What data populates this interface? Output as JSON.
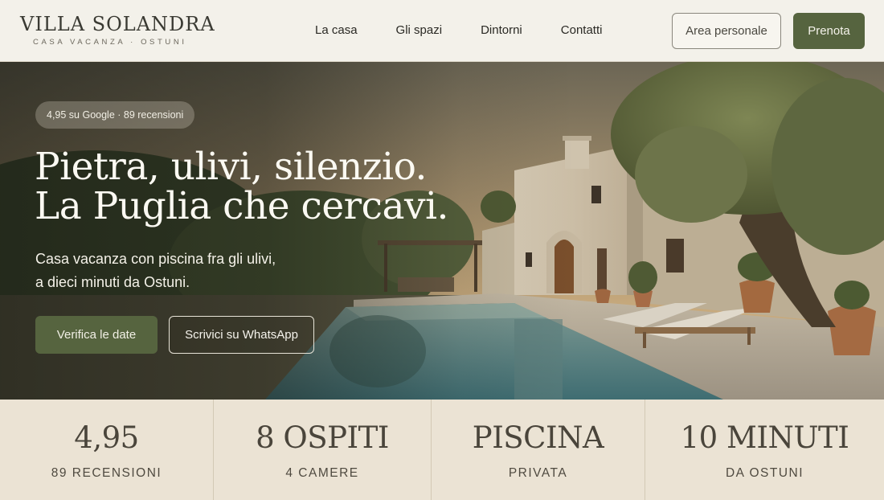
{
  "header": {
    "logo_name": "VILLA SOLANDRA",
    "logo_sub": "CASA VACANZA · OSTUNI",
    "nav": [
      "La casa",
      "Gli spazi",
      "Dintorni",
      "Contatti"
    ],
    "area_label": "Area personale",
    "book_label": "Prenota"
  },
  "hero": {
    "badge": "4,95 su Google · 89 recensioni",
    "headline": [
      "Pietra, ulivi, silenzio.",
      "La Puglia che cercavi."
    ],
    "subtitle": [
      "Casa vacanza con piscina fra gli ulivi,",
      "a dieci minuti da Ostuni."
    ],
    "cta_primary": "Verifica le date",
    "cta_secondary": "Scrivici su WhatsApp"
  },
  "stats": [
    {
      "value": "4,95",
      "label": "89 RECENSIONI"
    },
    {
      "value": "8 OSPITI",
      "label": "4 CAMERE"
    },
    {
      "value": "PISCINA",
      "label": "PRIVATA"
    },
    {
      "value": "10 MINUTI",
      "label": "DA OSTUNI"
    }
  ],
  "colors": {
    "accent": "#56643f",
    "header_bg": "#f3f1ea",
    "stats_bg": "#ebe3d4"
  }
}
